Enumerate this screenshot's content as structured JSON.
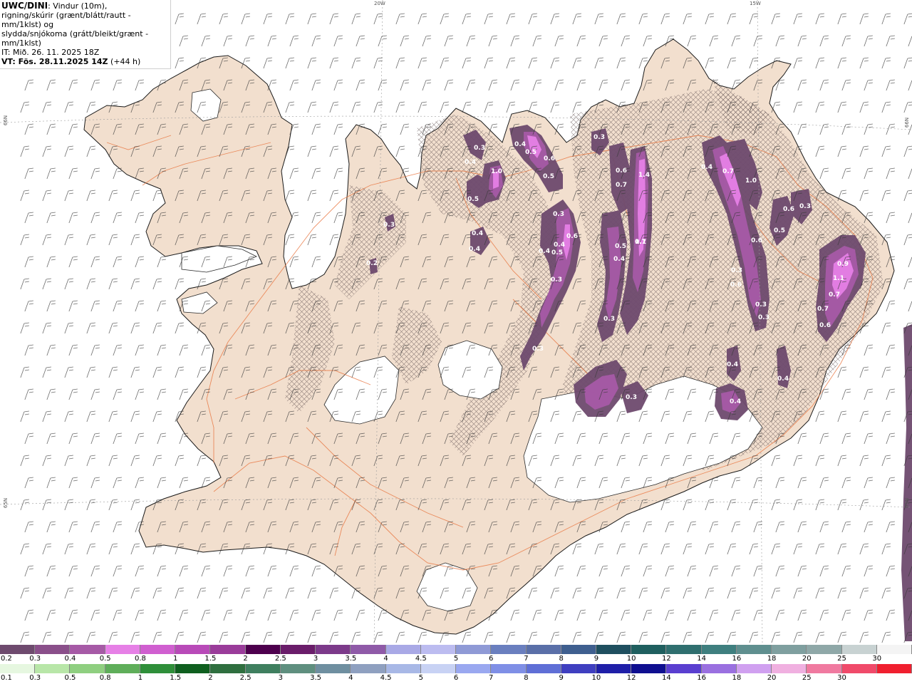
{
  "header": {
    "model": "UWC/DINI",
    "desc_line1": ": Vindur (10m),",
    "desc_line2": "rigning/skúrir (grænt/blátt/rautt - mm/1klst) og",
    "desc_line3": "slydda/snjókoma (grátt/bleikt/grænt - mm/1klst)",
    "it_line": "IT: Mið. 26. 11. 2025 18Z",
    "vt_line": "VT: Fös. 28.11.2025 14Z",
    "vt_lead": "(+44 h)"
  },
  "grid_labels": {
    "lon_20w": "20W",
    "lon_15w": "15W",
    "lat_66n_left": "66N",
    "lat_66n_right": "66N",
    "lat_65n_left": "65N",
    "lat_65n_right": "65N"
  },
  "precip_labels": [
    {
      "text": "0.3"
    },
    {
      "text": "0.4"
    },
    {
      "text": "1.0"
    },
    {
      "text": "0.5"
    },
    {
      "text": "0.4"
    },
    {
      "text": "0.5"
    },
    {
      "text": "0.6"
    },
    {
      "text": "0.5"
    },
    {
      "text": "0.3"
    },
    {
      "text": "0.6"
    },
    {
      "text": "1.4"
    },
    {
      "text": "0.7"
    },
    {
      "text": "0.4"
    },
    {
      "text": "0.7"
    },
    {
      "text": "1.0"
    },
    {
      "text": "0.6"
    },
    {
      "text": "0.3"
    },
    {
      "text": "0.5"
    },
    {
      "text": "0.6"
    },
    {
      "text": "0.4"
    },
    {
      "text": "0.4"
    },
    {
      "text": "0.4"
    },
    {
      "text": "0.4"
    },
    {
      "text": "0.5"
    },
    {
      "text": "0.3"
    },
    {
      "text": "0.5"
    },
    {
      "text": "0.4"
    },
    {
      "text": "0.6"
    },
    {
      "text": "0.3"
    },
    {
      "text": "0.7"
    },
    {
      "text": "0.3"
    },
    {
      "text": "0.6"
    },
    {
      "text": "0.3"
    },
    {
      "text": "0.4"
    },
    {
      "text": "0.4"
    },
    {
      "text": "0.4"
    },
    {
      "text": "0.9"
    },
    {
      "text": "1.1"
    },
    {
      "text": "0.7"
    },
    {
      "text": "0.7"
    },
    {
      "text": "0.6"
    },
    {
      "text": "0.3"
    },
    {
      "text": "0.3"
    },
    {
      "text": "0.3"
    },
    {
      "text": "0.2"
    },
    {
      "text": "0.3"
    },
    {
      "text": "0.3"
    },
    {
      "text": "1.1"
    }
  ],
  "legend_top": {
    "labels": [
      "0.2",
      "0.3",
      "0.4",
      "0.5",
      "0.8",
      "1",
      "1.5",
      "2",
      "2.5",
      "3",
      "3.5",
      "4",
      "4.5",
      "5",
      "6",
      "7",
      "8",
      "9",
      "10",
      "12",
      "14",
      "16",
      "18",
      "20",
      "25",
      "30"
    ],
    "colors": [
      "#6e4a6e",
      "#8a4f8a",
      "#a65aa6",
      "#e680e6",
      "#d05fd0",
      "#b84ab8",
      "#9a3c9a",
      "#4d004d",
      "#6a1d6a",
      "#7c3a8a",
      "#8f5aa8",
      "#a9a9e6",
      "#bcbcf0",
      "#8f9ad6",
      "#6a7fbf",
      "#5a6fa8",
      "#3f5f8f",
      "#1f4f5f",
      "#1f5f5f",
      "#2f6f6f",
      "#3f7f7f",
      "#5f8f8f",
      "#7f9f9f",
      "#8fa8a8",
      "#c8d2d2",
      "#f4f4f4"
    ]
  },
  "legend_bottom": {
    "labels": [
      "0.1",
      "0.3",
      "0.5",
      "0.8",
      "1",
      "1.5",
      "2",
      "2.5",
      "3",
      "3.5",
      "4",
      "4.5",
      "5",
      "6",
      "7",
      "8",
      "9",
      "10",
      "12",
      "14",
      "16",
      "18",
      "20",
      "25",
      "30"
    ],
    "colors": [
      "#e6f7e0",
      "#b8e6a8",
      "#8fcf80",
      "#5fae5a",
      "#2f8f3a",
      "#0f5f1f",
      "#2f6f3f",
      "#3f7f5f",
      "#5f8f7f",
      "#6f8fa0",
      "#8fa0c0",
      "#a8b8e6",
      "#c8d2f4",
      "#9aa8f0",
      "#7f8fe6",
      "#5f6fd6",
      "#3f3fc0",
      "#1f1fa8",
      "#0f0f90",
      "#5a3fd0",
      "#9a70e0",
      "#d0a0f0",
      "#f0b0e0",
      "#f07aa0",
      "#f04a6a",
      "#f01f2f"
    ]
  }
}
